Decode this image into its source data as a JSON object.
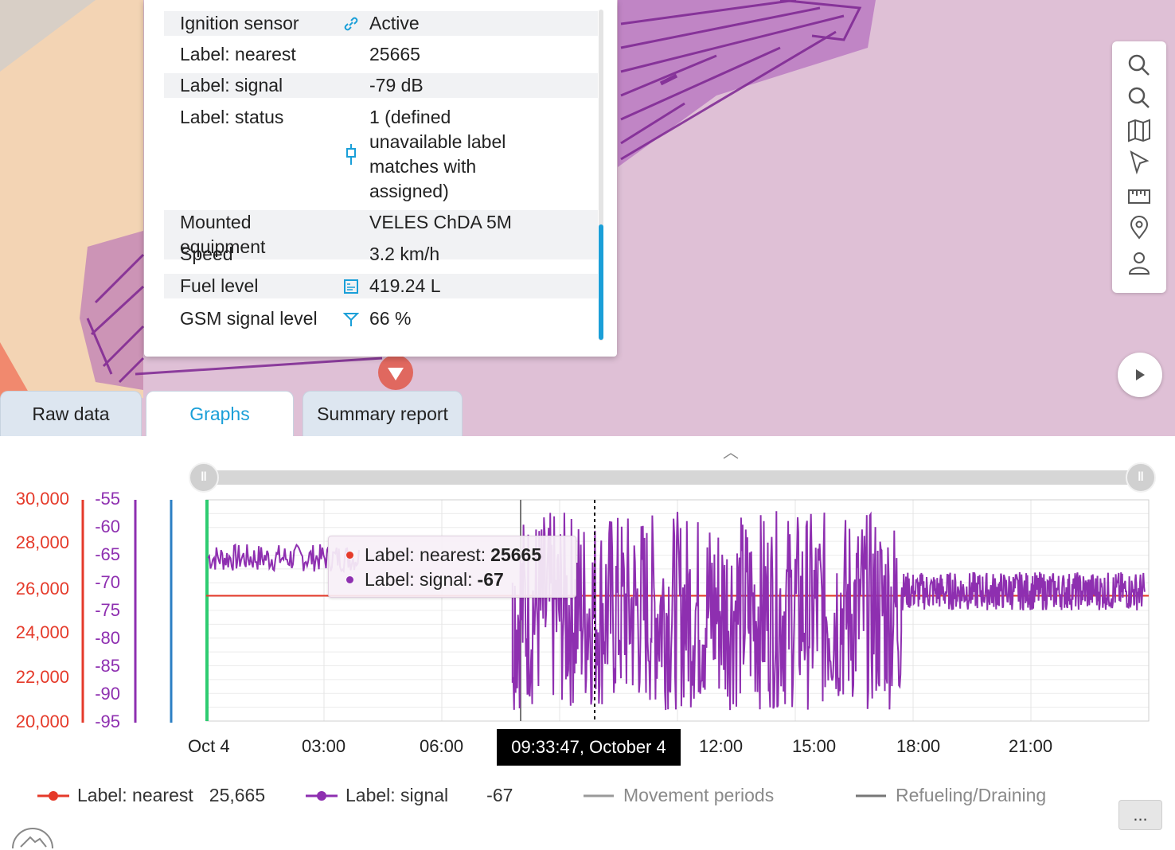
{
  "popup": {
    "rows": [
      {
        "label": "Ignition sensor",
        "icon": "link-icon",
        "value": "Active"
      },
      {
        "label": "Label: nearest",
        "icon": "",
        "value": "25665"
      },
      {
        "label": "Label: signal",
        "icon": "",
        "value": "-79 dB"
      },
      {
        "label": "Label: status",
        "icon": "plug-icon",
        "value": "1 (defined unavailable label matches with assigned)"
      },
      {
        "label": "Mounted equipment",
        "icon": "",
        "value": "VELES ChDA 5M"
      },
      {
        "label": "Speed",
        "icon": "",
        "value": "3.2 km/h"
      },
      {
        "label": "Fuel level",
        "icon": "fuel-sensor-icon",
        "value": "419.24 L"
      },
      {
        "label": "GSM signal level",
        "icon": "antenna-icon",
        "value": "66 %"
      }
    ]
  },
  "map_tools": [
    "zoom-in-icon",
    "zoom-out-icon",
    "map-layers-icon",
    "select-pointer-icon",
    "ruler-icon",
    "location-pin-icon",
    "user-icon"
  ],
  "tabs": [
    {
      "label": "Raw data",
      "active": false
    },
    {
      "label": "Graphs",
      "active": true
    },
    {
      "label": "Summary report",
      "active": false
    }
  ],
  "tooltip": {
    "nearest_label": "Label: nearest: ",
    "nearest_value": "25665",
    "signal_label": "Label: signal: ",
    "signal_value": "-67"
  },
  "cursor_time": "09:33:47, October 4",
  "legend": [
    {
      "name": "Label: nearest",
      "value": "25,665",
      "color": "#e53a2a"
    },
    {
      "name": "Label: signal",
      "value": "-67",
      "color": "#8e2fb0"
    },
    {
      "name": "Movement periods",
      "value": "",
      "color": "#9a9a9a"
    },
    {
      "name": "Refueling/Draining",
      "value": "",
      "color": "#777777"
    }
  ],
  "more_button": "...",
  "chart_data": {
    "type": "line",
    "x_ticks": [
      "Oct 4",
      "03:00",
      "06:00",
      "12:00",
      "15:00",
      "18:00",
      "21:00"
    ],
    "y_left_nearest_ticks": [
      "30,000",
      "28,000",
      "26,000",
      "24,000",
      "22,000",
      "20,000"
    ],
    "y_left_signal_ticks": [
      "-55",
      "-60",
      "-65",
      "-70",
      "-75",
      "-80",
      "-85",
      "-90",
      "-95"
    ],
    "ylim_nearest": [
      20000,
      30000
    ],
    "ylim_signal": [
      -95,
      -55
    ],
    "series": [
      {
        "name": "Label: nearest",
        "color": "#e53a2a",
        "values": [
          25665,
          25665
        ],
        "x_hours": [
          0,
          24
        ]
      },
      {
        "name": "Label: signal",
        "color": "#8e2fb0",
        "value_range_early": [
          -68,
          -63
        ],
        "value_range_midday": [
          -93,
          -57
        ],
        "value_range_evening": [
          -75,
          -68
        ]
      }
    ],
    "grid": true
  }
}
